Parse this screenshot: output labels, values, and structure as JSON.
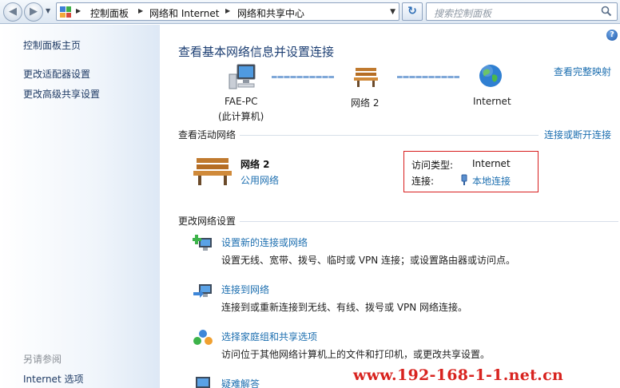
{
  "address_bar": {
    "back_icon": "back-arrow-icon",
    "forward_icon": "forward-arrow-icon",
    "crumbs": [
      "控制面板",
      "网络和 Internet",
      "网络和共享中心"
    ],
    "refresh_icon": "refresh-icon",
    "search_placeholder": "搜索控制面板"
  },
  "sidebar": {
    "items": [
      {
        "label": "控制面板主页"
      },
      {
        "label": "更改适配器设置"
      },
      {
        "label": "更改高级共享设置"
      }
    ],
    "see_also_title": "另请参阅",
    "see_also_items": [
      {
        "label": "Internet 选项"
      }
    ]
  },
  "main": {
    "title": "查看基本网络信息并设置连接",
    "full_map_link": "查看完整映射",
    "map": {
      "computer_name": "FAE-PC",
      "computer_sub": "(此计算机)",
      "network_name": "网络  2",
      "internet_label": "Internet"
    },
    "active_networks": {
      "heading": "查看活动网络",
      "connect_link": "连接或断开连接",
      "network_name": "网络  2",
      "network_type": "公用网络",
      "access_type_label": "访问类型:",
      "access_type_value": "Internet",
      "connections_label": "连接:",
      "connection_value": "本地连接"
    },
    "change_settings": {
      "heading": "更改网络设置",
      "tasks": [
        {
          "link": "设置新的连接或网络",
          "desc": "设置无线、宽带、拨号、临时或 VPN 连接；或设置路由器或访问点。",
          "icon": "new-connection-icon"
        },
        {
          "link": "连接到网络",
          "desc": "连接到或重新连接到无线、有线、拨号或 VPN 网络连接。",
          "icon": "connect-network-icon"
        },
        {
          "link": "选择家庭组和共享选项",
          "desc": "访问位于其他网络计算机上的文件和打印机，或更改共享设置。",
          "icon": "homegroup-icon"
        },
        {
          "link": "疑难解答",
          "desc": "",
          "icon": "troubleshoot-icon"
        }
      ]
    }
  },
  "watermark": "www.192-168-1-1.net.cn",
  "colors": {
    "link": "#1d6fb0",
    "title": "#1d3f73",
    "highlight_box": "#d81e1e",
    "watermark": "#d8231f"
  }
}
